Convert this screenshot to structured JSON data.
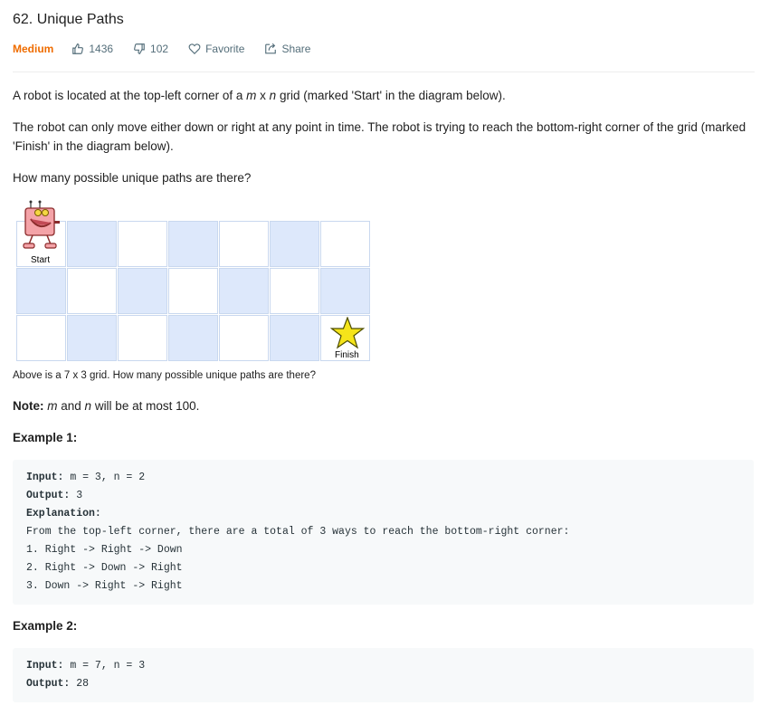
{
  "problem": {
    "title": "62. Unique Paths",
    "difficulty": "Medium",
    "likes": "1436",
    "dislikes": "102",
    "favorite_label": "Favorite",
    "share_label": "Share"
  },
  "description": {
    "p1_a": "A robot is located at the top-left corner of a ",
    "p1_m": "m",
    "p1_x": " x ",
    "p1_n": "n",
    "p1_b": " grid (marked 'Start' in the diagram below).",
    "p2": "The robot can only move either down or right at any point in time. The robot is trying to reach the bottom-right corner of the grid (marked 'Finish' in the diagram below).",
    "p3": "How many possible unique paths are there?"
  },
  "figure": {
    "start_label": "Start",
    "finish_label": "Finish",
    "caption": "Above is a 7 x 3 grid. How many possible unique paths are there?",
    "colors": {
      "blue_cell": "#dde8fb",
      "border": "#c9d8ef",
      "star": "#f5e41a",
      "robot": "#f4a3a8"
    }
  },
  "note": {
    "label": "Note:",
    "m": "m",
    "and": " and ",
    "n": "n",
    "rest": " will be at most 100."
  },
  "example1": {
    "heading": "Example 1:",
    "input_label": "Input:",
    "input_value": " m = 3, n = 2",
    "output_label": "Output:",
    "output_value": " 3",
    "explanation_label": "Explanation:",
    "lines": [
      "From the top-left corner, there are a total of 3 ways to reach the bottom-right corner:",
      "1. Right -> Right -> Down",
      "2. Right -> Down -> Right",
      "3. Down -> Right -> Right"
    ]
  },
  "example2": {
    "heading": "Example 2:",
    "input_label": "Input:",
    "input_value": " m = 7, n = 3",
    "output_label": "Output:",
    "output_value": " 28"
  },
  "colors": {
    "difficulty": "#ef6c00",
    "meta_text": "#546e7a",
    "code_bg": "#f7f9fa"
  }
}
